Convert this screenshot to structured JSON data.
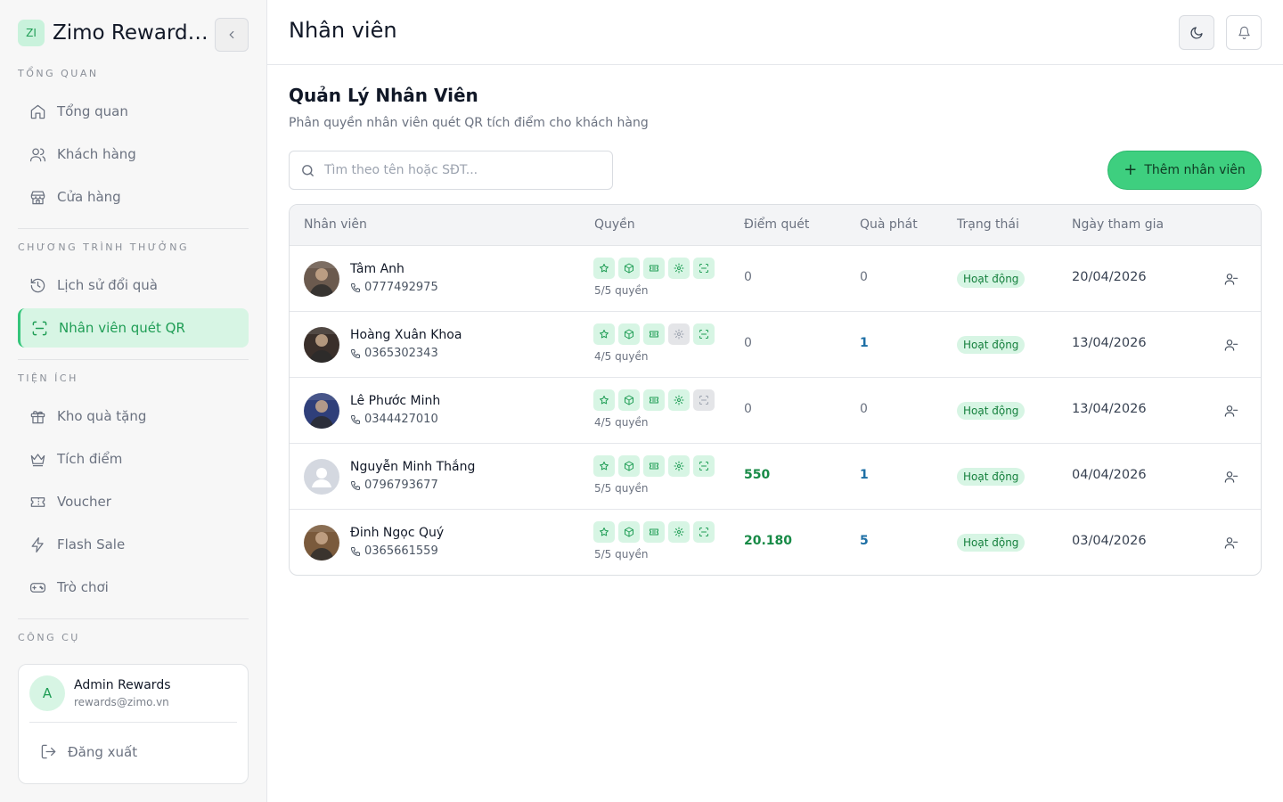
{
  "brand": {
    "logo_text": "ZI",
    "title": "Zimo Rewards Admin"
  },
  "sidebar": {
    "sections": [
      {
        "label": "TỔNG QUAN"
      },
      {
        "label": "CHƯƠNG TRÌNH THƯỞNG"
      },
      {
        "label": "TIỆN ÍCH"
      },
      {
        "label": "CÔNG CỤ"
      }
    ],
    "items": [
      {
        "label": "Tổng quan",
        "icon": "home-icon"
      },
      {
        "label": "Khách hàng",
        "icon": "users-icon"
      },
      {
        "label": "Cửa hàng",
        "icon": "store-icon"
      },
      {
        "label": "Lịch sử đổi quà",
        "icon": "history-icon"
      },
      {
        "label": "Nhân viên quét QR",
        "icon": "scan-icon",
        "active": true
      },
      {
        "label": "Kho quà tặng",
        "icon": "gift-icon"
      },
      {
        "label": "Tích điểm",
        "icon": "crown-icon"
      },
      {
        "label": "Voucher",
        "icon": "ticket-icon"
      },
      {
        "label": "Flash Sale",
        "icon": "zap-icon"
      },
      {
        "label": "Trò chơi",
        "icon": "gamepad-icon"
      }
    ],
    "user": {
      "initial": "A",
      "name": "Admin Rewards",
      "email": "rewards@zimo.vn"
    },
    "logout_label": "Đăng xuất"
  },
  "header": {
    "title": "Nhân viên"
  },
  "main": {
    "heading": "Quản Lý Nhân Viên",
    "subheading": "Phân quyền nhân viên quét QR tích điểm cho khách hàng",
    "search_placeholder": "Tìm theo tên hoặc SĐT...",
    "add_button": "Thêm nhân viên",
    "columns": [
      "Nhân viên",
      "Quyền",
      "Điểm quét",
      "Quà phát",
      "Trạng thái",
      "Ngày tham gia"
    ],
    "rows": [
      {
        "name": "Tâm Anh",
        "phone": "0777492975",
        "perms": [
          true,
          true,
          true,
          true,
          true
        ],
        "perm_count": "5/5 quyền",
        "points": "0",
        "gifts": "0",
        "status": "Hoạt động",
        "joined": "20/04/2026",
        "avatar_color": "#6b5a4e"
      },
      {
        "name": "Hoàng Xuân Khoa",
        "phone": "0365302343",
        "perms": [
          true,
          true,
          true,
          false,
          true
        ],
        "perm_count": "4/5 quyền",
        "points": "0",
        "gifts": "1",
        "status": "Hoạt động",
        "joined": "13/04/2026",
        "avatar_color": "#3a2f2a"
      },
      {
        "name": "Lê Phước Minh",
        "phone": "0344427010",
        "perms": [
          true,
          true,
          true,
          true,
          false
        ],
        "perm_count": "4/5 quyền",
        "points": "0",
        "gifts": "0",
        "status": "Hoạt động",
        "joined": "13/04/2026",
        "avatar_color": "#2f3f7a"
      },
      {
        "name": "Nguyễn Minh Thắng",
        "phone": "0796793677",
        "perms": [
          true,
          true,
          true,
          true,
          true
        ],
        "perm_count": "5/5 quyền",
        "points": "550",
        "gifts": "1",
        "status": "Hoạt động",
        "joined": "04/04/2026",
        "avatar_color": "#d4d8e0"
      },
      {
        "name": "Đinh Ngọc Quý",
        "phone": "0365661559",
        "perms": [
          true,
          true,
          true,
          true,
          true
        ],
        "perm_count": "5/5 quyền",
        "points": "20.180",
        "gifts": "5",
        "status": "Hoạt động",
        "joined": "03/04/2026",
        "avatar_color": "#7a5a3c"
      }
    ]
  },
  "colors": {
    "accent": "#3ecf7f",
    "accent_soft": "#d7f5e4",
    "accent_text": "#1f9d55"
  }
}
